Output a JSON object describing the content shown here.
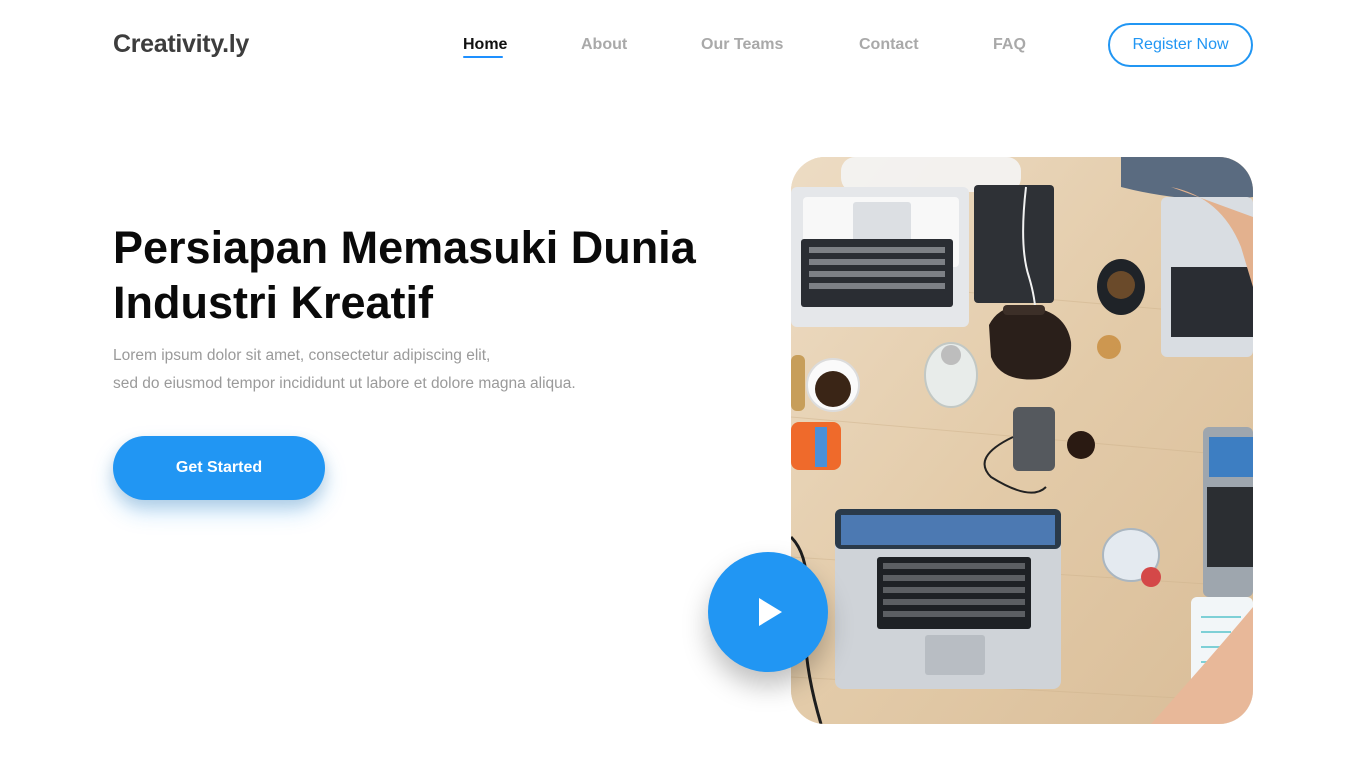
{
  "brand": {
    "logo_text": "Creativity.ly",
    "accent_color": "#2196f3"
  },
  "nav": {
    "items": [
      {
        "label": "Home",
        "active": true
      },
      {
        "label": "About",
        "active": false
      },
      {
        "label": "Our Teams",
        "active": false
      },
      {
        "label": "Contact",
        "active": false
      },
      {
        "label": "FAQ",
        "active": false
      }
    ],
    "register_label": "Register Now"
  },
  "hero": {
    "title_line1": "Persiapan Memasuki Dunia",
    "title_line2": "Industri Kreatif",
    "desc_line1": "Lorem ipsum dolor sit amet, consectetur adipiscing elit,",
    "desc_line2": "sed do eiusmod tempor incididunt ut labore et dolore magna aliqua.",
    "cta_label": "Get Started",
    "image_icon": "workspace-photo",
    "play_icon": "play-icon"
  }
}
